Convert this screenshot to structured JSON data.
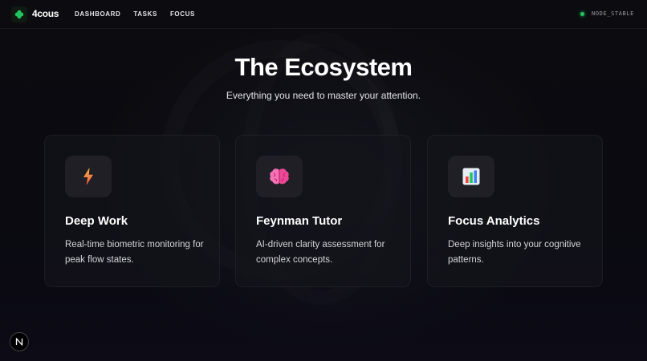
{
  "nav": {
    "brand": "4cous",
    "links": [
      "DASHBOARD",
      "TASKS",
      "FOCUS"
    ],
    "status_text": "NODE_STABLE",
    "status_color": "#22c55e"
  },
  "hero": {
    "title": "The Ecosystem",
    "subtitle": "Everything you need to master your attention."
  },
  "cards": [
    {
      "icon": "lightning-icon",
      "title": "Deep Work",
      "description": "Real-time biometric monitoring for peak flow states."
    },
    {
      "icon": "brain-icon",
      "title": "Feynman Tutor",
      "description": "AI-driven clarity assessment for complex concepts."
    },
    {
      "icon": "bar-chart-icon",
      "title": "Focus Analytics",
      "description": "Deep insights into your cognitive patterns."
    }
  ],
  "badge": {
    "icon": "n-logo-icon"
  },
  "colors": {
    "background": "#0a0a0f",
    "accent_green": "#22c55e",
    "card_bg": "#14141a"
  }
}
